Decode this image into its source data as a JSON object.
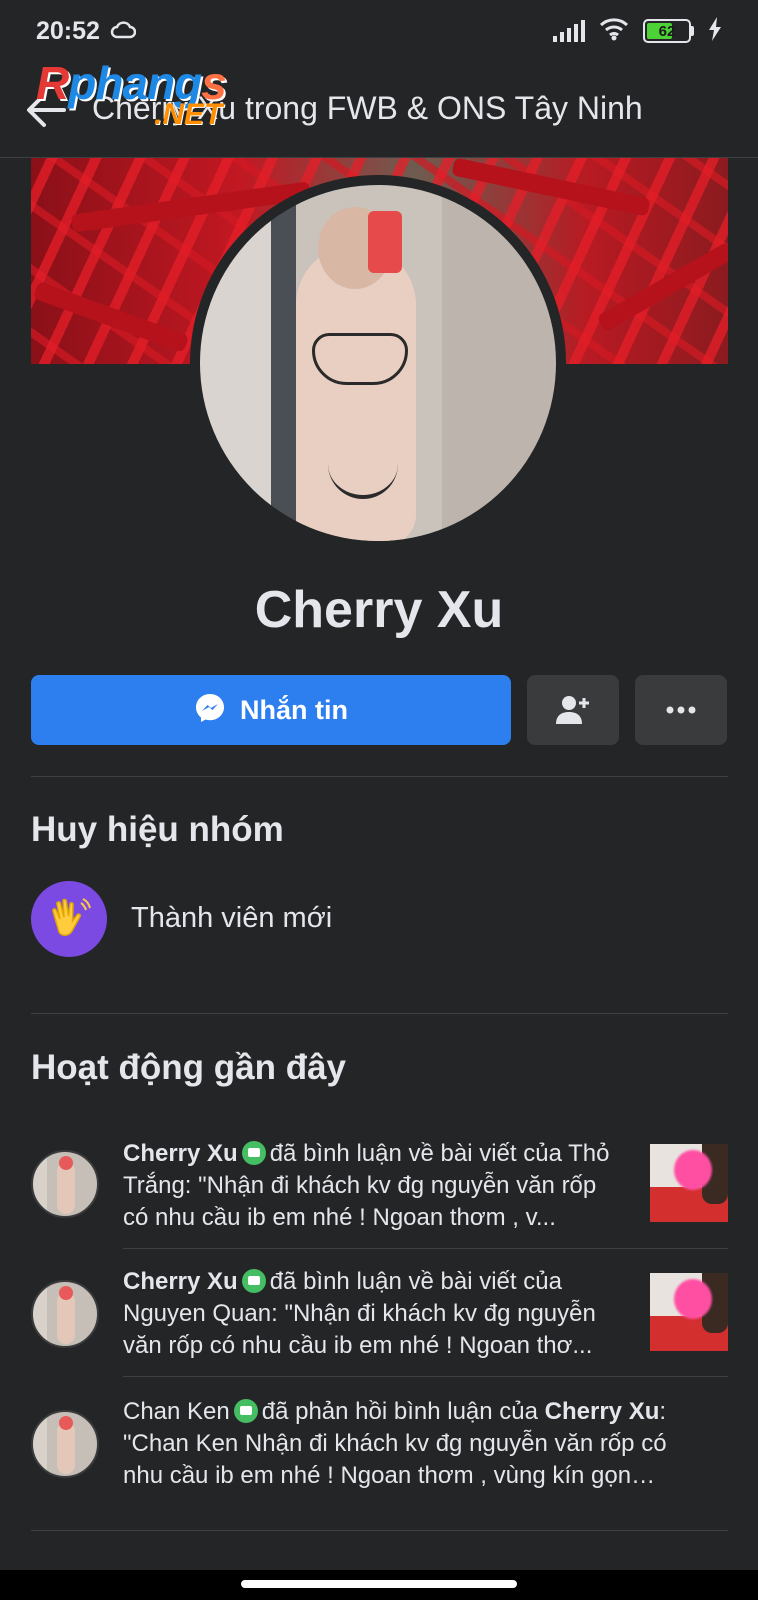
{
  "status_bar": {
    "time": "20:52",
    "battery": "62",
    "icons": [
      "cloud-icon",
      "signal-icon",
      "wifi-icon",
      "battery-icon",
      "charging-icon"
    ]
  },
  "header": {
    "title": "Cherry Xu trong FWB & ONS Tây Ninh",
    "watermark_main": "Rphangs",
    "watermark_suffix": ".NET"
  },
  "profile": {
    "name": "Cherry Xu"
  },
  "actions": {
    "message_label": "Nhắn tin",
    "add_friend_icon": "add-friend-icon",
    "more_icon": "more-icon"
  },
  "badges": {
    "title": "Huy hiệu nhóm",
    "items": [
      {
        "label": "Thành viên mới",
        "icon": "waving-hand-icon"
      }
    ]
  },
  "activity": {
    "title": "Hoạt động gần đây",
    "items": [
      {
        "actor": "Cherry Xu",
        "verb": "đã bình luận về bài viết của Thỏ Trắng: \"Nhận đi khách kv đg nguyễn văn rốp có nhu cầu ib em nhé ! Ngoan thơm , v..."
      },
      {
        "actor": "Cherry Xu",
        "verb": "đã bình luận về bài viết của Nguyen Quan: \"Nhận đi khách kv đg nguyễn văn rốp có nhu cầu ib em nhé ! Ngoan thơ..."
      },
      {
        "actor": "Chan Ken",
        "verb": "đã phản hồi bình luận của",
        "target": "Cherry Xu",
        "rest": ": \"Chan Ken Nhận đi khách kv đg nguyễn văn rốp có nhu cầu ib em nhé ! Ngoan thơm , vùng kín gọn gà..."
      }
    ]
  },
  "colors": {
    "background": "#242526",
    "primary_button": "#2d7ff0",
    "secondary_button": "#3a3b3c",
    "badge_bg": "#7b4ae2",
    "messenger_green": "#45bd62"
  }
}
